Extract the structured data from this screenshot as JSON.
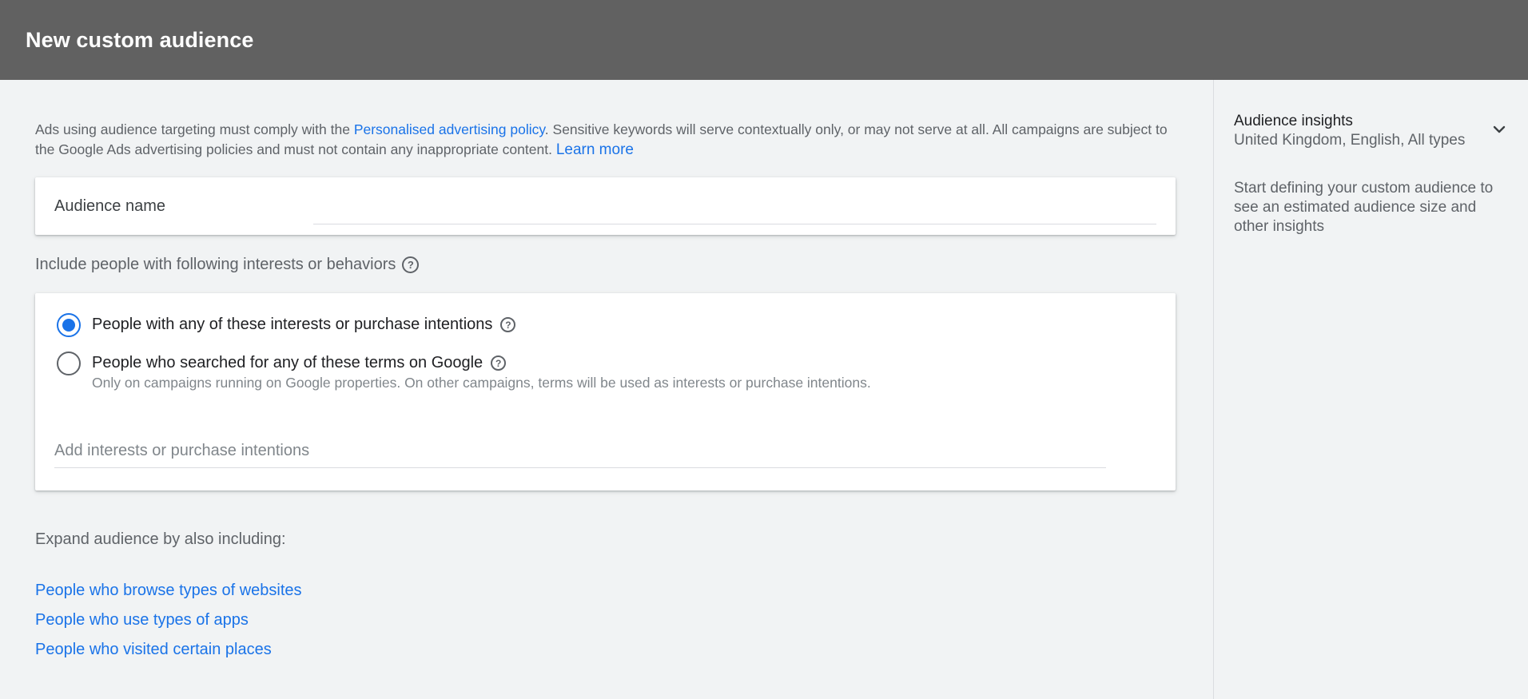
{
  "header": {
    "title": "New custom audience"
  },
  "policy": {
    "text_before": "Ads using audience targeting must comply with the ",
    "link_policy": "Personalised advertising policy",
    "text_after": ". Sensitive keywords will serve contextually only, or may not serve at all. All campaigns are subject to the Google Ads advertising policies and must not contain any inappropriate content. ",
    "link_learn": "Learn more"
  },
  "audience_name": {
    "label": "Audience name",
    "value": ""
  },
  "include": {
    "label": "Include people with following interests or behaviors",
    "options": [
      {
        "label": "People with any of these interests or purchase intentions",
        "selected": true
      },
      {
        "label": "People who searched for any of these terms on Google",
        "sublabel": "Only on campaigns running on Google properties. On other campaigns, terms will be used as interests or purchase intentions.",
        "selected": false
      }
    ],
    "input_placeholder": "Add interests or purchase intentions"
  },
  "expand": {
    "label": "Expand audience by also including:",
    "links": [
      "People who browse types of websites",
      "People who use types of apps",
      "People who visited certain places"
    ]
  },
  "insights": {
    "title": "Audience insights",
    "subtitle": "United Kingdom, English, All types",
    "description": "Start defining your custom audience to see an estimated audience size and other insights"
  },
  "colors": {
    "accent": "#1a73e8",
    "header_bg": "#616161",
    "page_bg": "#f1f3f4"
  },
  "icons": {
    "help": "help-circle-icon",
    "chevron": "chevron-down-icon"
  }
}
